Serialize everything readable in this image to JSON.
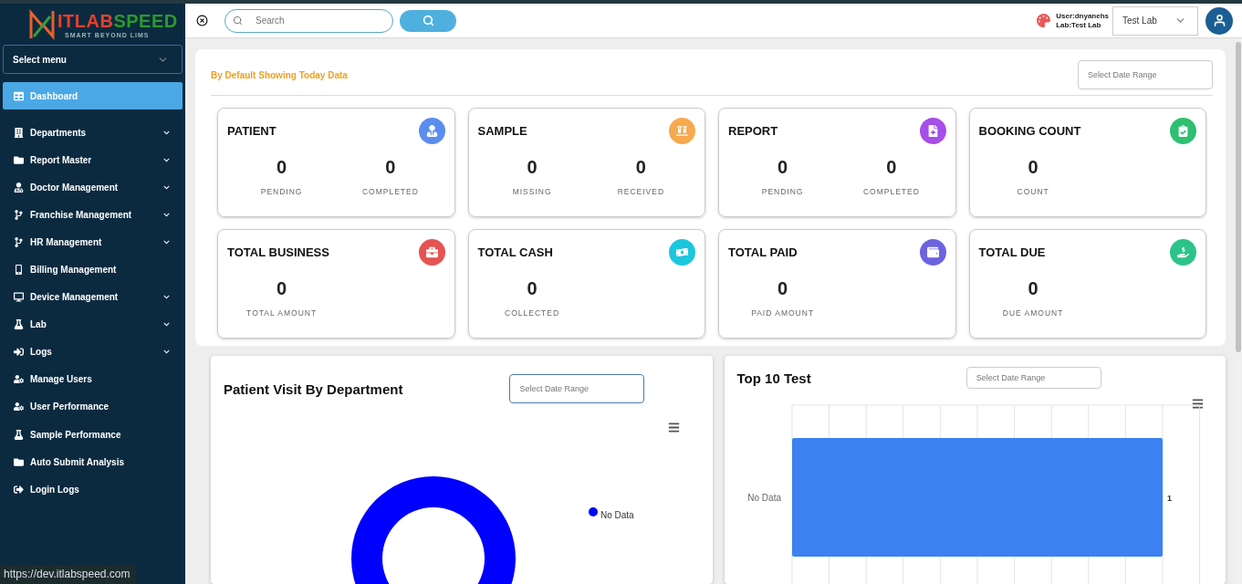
{
  "logo": {
    "brand_first": "ITLAB",
    "brand_second": "SPEED",
    "tagline": "SMART BEYOND LIMS"
  },
  "sidebar": {
    "select_menu": "Select menu",
    "items": [
      {
        "label": "Dashboard",
        "selected": true,
        "expandable": false
      },
      {
        "label": "Departments",
        "selected": false,
        "expandable": true
      },
      {
        "label": "Report Master",
        "selected": false,
        "expandable": true
      },
      {
        "label": "Doctor Management",
        "selected": false,
        "expandable": true
      },
      {
        "label": "Franchise Management",
        "selected": false,
        "expandable": true
      },
      {
        "label": "HR Management",
        "selected": false,
        "expandable": true
      },
      {
        "label": "Billing Management",
        "selected": false,
        "expandable": false
      },
      {
        "label": "Device Management",
        "selected": false,
        "expandable": true
      },
      {
        "label": "Lab",
        "selected": false,
        "expandable": true
      },
      {
        "label": "Logs",
        "selected": false,
        "expandable": true
      },
      {
        "label": "Manage Users",
        "selected": false,
        "expandable": false
      },
      {
        "label": "User Performance",
        "selected": false,
        "expandable": false
      },
      {
        "label": "Sample Performance",
        "selected": false,
        "expandable": false
      },
      {
        "label": "Auto Submit Analysis",
        "selected": false,
        "expandable": false
      },
      {
        "label": "Login Logs",
        "selected": false,
        "expandable": false
      }
    ]
  },
  "header": {
    "search": {
      "placeholder": "Search"
    },
    "user": "User:dnyanehs",
    "lab": "Lab:Test Lab",
    "lab_select": "Test Lab"
  },
  "overview": {
    "note": "By Default Showing Today Data",
    "date_range": {
      "placeholder": "Select Date Range"
    },
    "cards": [
      {
        "title": "PATIENT",
        "color": "#5b8def",
        "stats": [
          {
            "value": "0",
            "label": "PENDING"
          },
          {
            "value": "0",
            "label": "COMPLETED"
          }
        ]
      },
      {
        "title": "SAMPLE",
        "color": "#f7a94f",
        "stats": [
          {
            "value": "0",
            "label": "MISSING"
          },
          {
            "value": "0",
            "label": "RECEIVED"
          }
        ]
      },
      {
        "title": "REPORT",
        "color": "#a64ee8",
        "stats": [
          {
            "value": "0",
            "label": "PENDING"
          },
          {
            "value": "0",
            "label": "COMPLETED"
          }
        ]
      },
      {
        "title": "BOOKING COUNT",
        "color": "#2fbf71",
        "stats": [
          {
            "value": "0",
            "label": "COUNT"
          }
        ]
      },
      {
        "title": "TOTAL BUSINESS",
        "color": "#e55353",
        "stats": [
          {
            "value": "0",
            "label": "TOTAL AMOUNT"
          }
        ]
      },
      {
        "title": "TOTAL CASH",
        "color": "#1cc6dd",
        "stats": [
          {
            "value": "0",
            "label": "COLLECTED"
          }
        ]
      },
      {
        "title": "TOTAL PAID",
        "color": "#6c63e0",
        "stats": [
          {
            "value": "0",
            "label": "PAID AMOUNT"
          }
        ]
      },
      {
        "title": "TOTAL DUE",
        "color": "#2cc38a",
        "stats": [
          {
            "value": "0",
            "label": "DUE AMOUNT"
          }
        ]
      }
    ]
  },
  "panels": [
    {
      "kind": "donut",
      "title": "Patient Visit By Department",
      "date_range": {
        "placeholder": "Select Date Range"
      },
      "legend": "No Data"
    },
    {
      "kind": "bar",
      "title": "Top 10 Test",
      "date_range": {
        "placeholder": "Select Date Range"
      },
      "category_label": "No Data",
      "bar_label": "1"
    }
  ],
  "status_url": "https://dev.itlabspeed.com"
}
